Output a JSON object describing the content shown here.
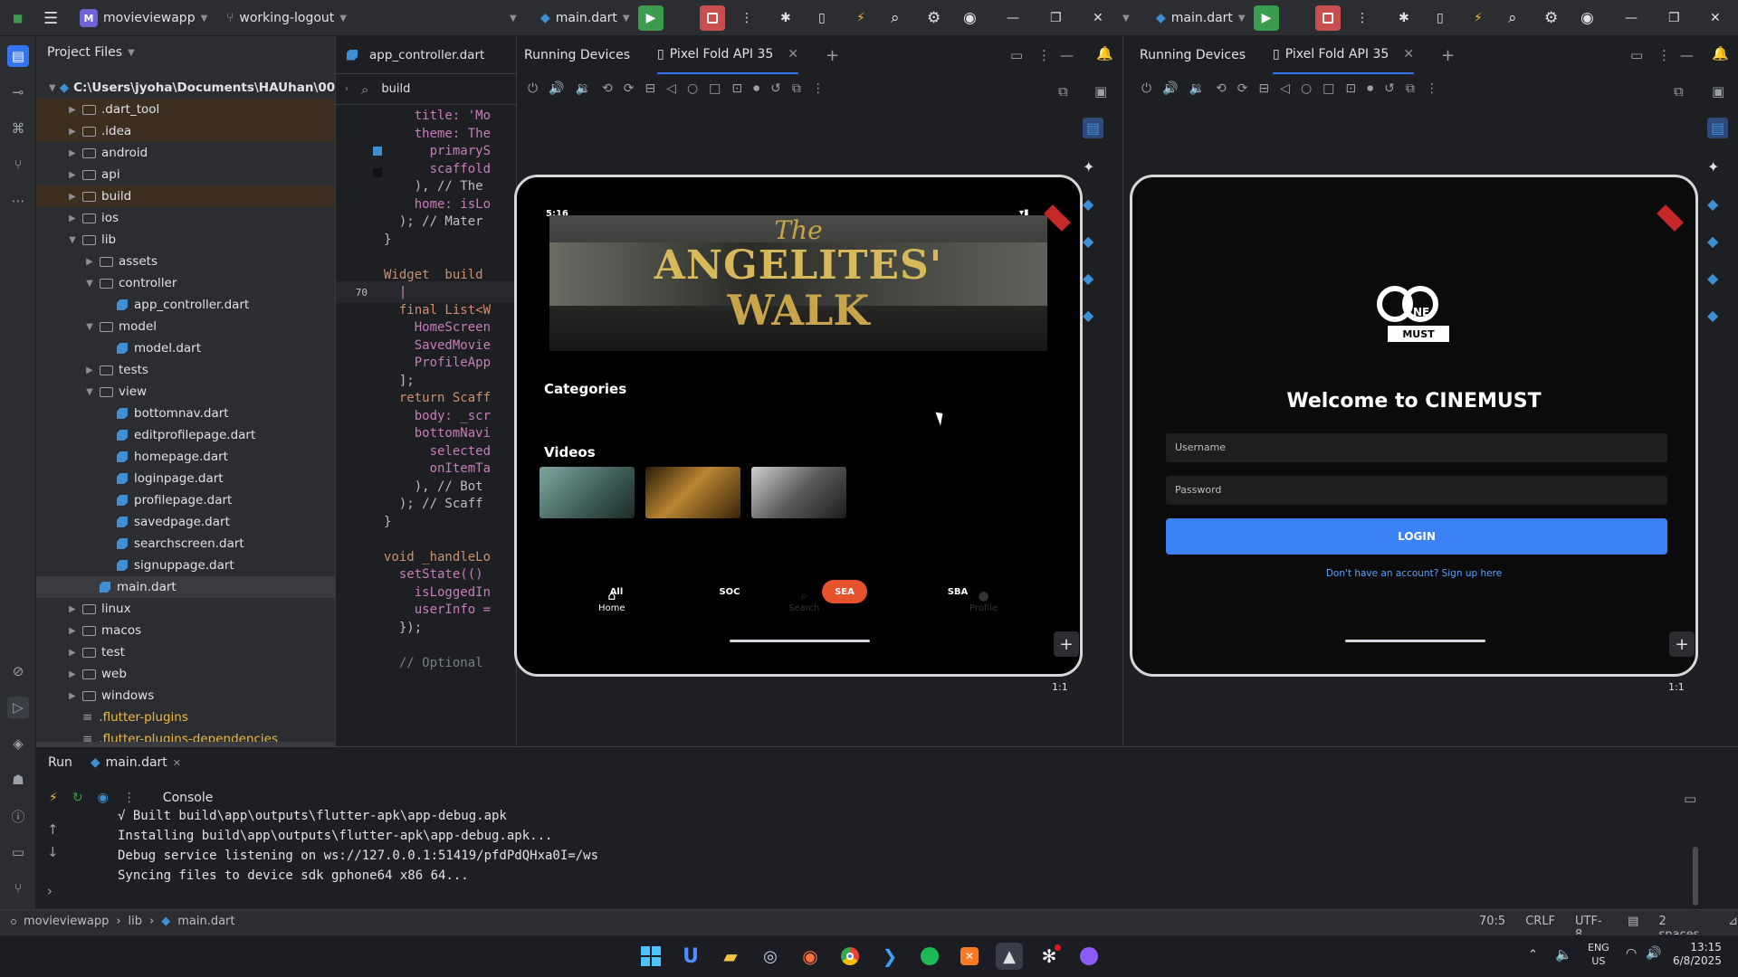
{
  "titlebar": {
    "project_badge": "M",
    "project_name": "movieviewapp",
    "branch": "working-logout",
    "run_config": "main.dart",
    "run_config_2": "main.dart"
  },
  "project_panel": {
    "title": "Project Files",
    "root_path": "C:\\Users\\jyoha\\Documents\\HAUhan\\00 DON",
    "items": [
      {
        "label": ".dart_tool",
        "type": "folder",
        "depth": 1
      },
      {
        "label": ".idea",
        "type": "folder",
        "depth": 1
      },
      {
        "label": "android",
        "type": "folder",
        "depth": 1
      },
      {
        "label": "api",
        "type": "folder",
        "depth": 1
      },
      {
        "label": "build",
        "type": "folder",
        "depth": 1
      },
      {
        "label": "ios",
        "type": "folder",
        "depth": 1
      },
      {
        "label": "lib",
        "type": "folder",
        "depth": 1
      },
      {
        "label": "assets",
        "type": "folder",
        "depth": 2
      },
      {
        "label": "controller",
        "type": "folder",
        "depth": 2
      },
      {
        "label": "app_controller.dart",
        "type": "file",
        "depth": 3
      },
      {
        "label": "model",
        "type": "folder",
        "depth": 2
      },
      {
        "label": "model.dart",
        "type": "file",
        "depth": 3
      },
      {
        "label": "tests",
        "type": "folder",
        "depth": 2
      },
      {
        "label": "view",
        "type": "folder",
        "depth": 2
      },
      {
        "label": "bottomnav.dart",
        "type": "file",
        "depth": 3
      },
      {
        "label": "editprofilepage.dart",
        "type": "file",
        "depth": 3
      },
      {
        "label": "homepage.dart",
        "type": "file",
        "depth": 3
      },
      {
        "label": "loginpage.dart",
        "type": "file",
        "depth": 3
      },
      {
        "label": "profilepage.dart",
        "type": "file",
        "depth": 3
      },
      {
        "label": "savedpage.dart",
        "type": "file",
        "depth": 3
      },
      {
        "label": "searchscreen.dart",
        "type": "file",
        "depth": 3
      },
      {
        "label": "signuppage.dart",
        "type": "file",
        "depth": 3
      },
      {
        "label": "main.dart",
        "type": "file",
        "depth": 2
      },
      {
        "label": "linux",
        "type": "folder",
        "depth": 1
      },
      {
        "label": "macos",
        "type": "folder",
        "depth": 1
      },
      {
        "label": "test",
        "type": "folder",
        "depth": 1
      },
      {
        "label": "web",
        "type": "folder",
        "depth": 1
      },
      {
        "label": "windows",
        "type": "folder",
        "depth": 1
      },
      {
        "label": ".flutter-plugins",
        "type": "plain",
        "depth": 1
      },
      {
        "label": ".flutter-plugins-dependencies",
        "type": "plain",
        "depth": 1
      }
    ]
  },
  "editor": {
    "tab": "app_controller.dart",
    "search_value": "build",
    "lines": [
      {
        "n": "",
        "t": "    title: 'Mo"
      },
      {
        "n": "",
        "t": "    theme: The"
      },
      {
        "n": "",
        "t": "      primaryS"
      },
      {
        "n": "",
        "t": "      scaffold"
      },
      {
        "n": "",
        "t": "    ), // The"
      },
      {
        "n": "",
        "t": "    home: isLo"
      },
      {
        "n": "",
        "t": "  ); // Mater"
      },
      {
        "n": "",
        "t": "}"
      },
      {
        "n": "",
        "t": ""
      },
      {
        "n": "",
        "t": "Widget _build"
      },
      {
        "n": "70",
        "t": "  |"
      },
      {
        "n": "",
        "t": "  final List<W"
      },
      {
        "n": "",
        "t": "    HomeScreen"
      },
      {
        "n": "",
        "t": "    SavedMovie"
      },
      {
        "n": "",
        "t": "    ProfileApp"
      },
      {
        "n": "",
        "t": "  ];"
      },
      {
        "n": "",
        "t": "  return Scaff"
      },
      {
        "n": "",
        "t": "    body: _scr"
      },
      {
        "n": "",
        "t": "    bottomNavi"
      },
      {
        "n": "",
        "t": "      selected"
      },
      {
        "n": "",
        "t": "      onItemTa"
      },
      {
        "n": "",
        "t": "    ), // Bot"
      },
      {
        "n": "",
        "t": "  ); // Scaff"
      },
      {
        "n": "",
        "t": "}"
      },
      {
        "n": "",
        "t": ""
      },
      {
        "n": "",
        "t": "void _handleLo"
      },
      {
        "n": "",
        "t": "  setState(()"
      },
      {
        "n": "",
        "t": "    isLoggedIn"
      },
      {
        "n": "",
        "t": "    userInfo ="
      },
      {
        "n": "",
        "t": "  });"
      },
      {
        "n": "",
        "t": ""
      },
      {
        "n": "",
        "t": "  // Optional"
      }
    ]
  },
  "devices_left": {
    "title": "Running Devices",
    "tab": "Pixel Fold API 35",
    "ratio": "1:1",
    "phone": {
      "time": "5:16",
      "hero_line1": "The",
      "hero_line2": "ANGELITES'",
      "hero_line3": "WALK",
      "categories_title": "Categories",
      "categories": [
        "All",
        "SOC",
        "SEA",
        "SBA"
      ],
      "videos_title": "Videos",
      "nav_home": "Home",
      "nav_search": "Search",
      "nav_profile": "Profile"
    }
  },
  "devices_right": {
    "title": "Running Devices",
    "tab": "Pixel Fold API 35",
    "ratio": "1:1",
    "phone": {
      "logo_text_1": "NE",
      "logo_text_2": "MUST",
      "welcome": "Welcome to CINEMUST",
      "username_placeholder": "Username",
      "password_placeholder": "Password",
      "login": "LOGIN",
      "signup": "Don't have an account? Sign up here"
    }
  },
  "run": {
    "tab_run": "Run",
    "tab_file": "main.dart",
    "console_label": "Console",
    "lines": [
      "√ Built build\\app\\outputs\\flutter-apk\\app-debug.apk",
      "Installing build\\app\\outputs\\flutter-apk\\app-debug.apk...",
      "Debug service listening on ws://127.0.0.1:51419/pfdPdQHxa0I=/ws",
      "Syncing files to device sdk gphone64 x86 64..."
    ]
  },
  "statusbar": {
    "crumb_1": "movieviewapp",
    "crumb_2": "lib",
    "crumb_3": "main.dart",
    "position": "70:5",
    "line_sep": "CRLF",
    "encoding": "UTF-8",
    "indent": "2 spaces"
  },
  "taskbar": {
    "lang_1": "ENG",
    "lang_2": "US",
    "time": "13:15",
    "date": "6/8/2025"
  },
  "colors": {
    "accent_red": "#e6522c",
    "login_blue": "#3b82f6",
    "run_green": "#3a9c4c",
    "stop_red": "#c94f4f"
  }
}
